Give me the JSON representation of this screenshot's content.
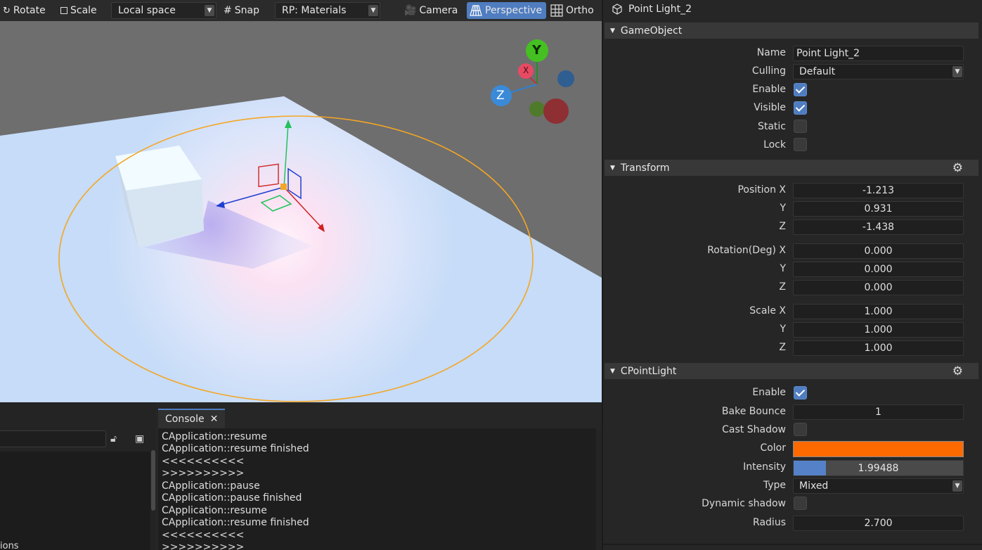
{
  "toolbar": {
    "rotate_label": "Rotate",
    "scale_label": "Scale",
    "space_select": "Local space",
    "snap_label": "Snap",
    "rp_select": "RP: Materials",
    "camera_label": "Camera",
    "perspective_label": "Perspective",
    "ortho_label": "Ortho"
  },
  "gizmo": {
    "y_label": "Y",
    "x_label": "X",
    "z_label": "Z"
  },
  "console": {
    "tab_label": "Console",
    "lines": [
      "CApplication::resume",
      "CApplication::resume finished",
      "<<<<<<<<<<",
      ">>>>>>>>>>",
      "CApplication::pause",
      "CApplication::pause finished",
      "CApplication::resume",
      "CApplication::resume finished",
      "<<<<<<<<<<",
      ">>>>>>>>>>"
    ]
  },
  "left_panel": {
    "partial_text": "ions"
  },
  "inspector": {
    "title": "Point Light_2",
    "gameobject": {
      "header": "GameObject",
      "name_label": "Name",
      "name_value": "Point Light_2",
      "culling_label": "Culling",
      "culling_value": "Default",
      "enable_label": "Enable",
      "visible_label": "Visible",
      "static_label": "Static",
      "lock_label": "Lock",
      "enable": true,
      "visible": true,
      "static": false,
      "lock": false
    },
    "transform": {
      "header": "Transform",
      "position_x_label": "Position X",
      "rotation_x_label": "Rotation(Deg) X",
      "scale_x_label": "Scale X",
      "y_label": "Y",
      "z_label": "Z",
      "position": [
        "-1.213",
        "0.931",
        "-1.438"
      ],
      "rotation": [
        "0.000",
        "0.000",
        "0.000"
      ],
      "scale": [
        "1.000",
        "1.000",
        "1.000"
      ]
    },
    "pointlight": {
      "header": "CPointLight",
      "enable_label": "Enable",
      "enable": true,
      "bake_bounce_label": "Bake Bounce",
      "bake_bounce_value": "1",
      "cast_shadow_label": "Cast Shadow",
      "cast_shadow": false,
      "color_label": "Color",
      "color_hex": "#ff6a00",
      "intensity_label": "Intensity",
      "intensity_value": "1.99488",
      "intensity_fill_fraction": 0.19,
      "type_label": "Type",
      "type_value": "Mixed",
      "dynamic_shadow_label": "Dynamic shadow",
      "dynamic_shadow": false,
      "radius_label": "Radius",
      "radius_value": "2.700"
    }
  },
  "colors": {
    "accent": "#4f7dc0",
    "panel": "#262626",
    "light_color": "#ff6a00"
  }
}
